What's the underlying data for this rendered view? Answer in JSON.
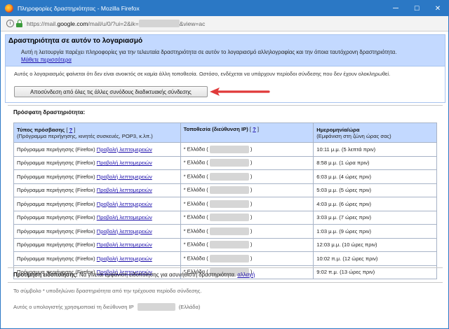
{
  "window": {
    "title": "Πληροφορίες δραστηριότητας - Mozilla Firefox",
    "controls": {
      "minimize": "─",
      "maximize": "☐",
      "close": "✕"
    }
  },
  "urlbar": {
    "prefix": "https://mail.",
    "domain": "google.com",
    "path": "/mail/u/0/?ui=2&ik=",
    "suffix": "&view=ac"
  },
  "banner": {
    "heading": "Δραστηριότητα σε αυτόν το λογαριασμό",
    "description": "Αυτή η λειτουργία παρέχει πληροφορίες για την τελευταία δραστηριότητα σε αυτόν το λογαριασμό αλληλογραφίας και την όποια ταυτόχρονη δραστηριότητα.",
    "learn_more": "Μάθετε περισσότερα"
  },
  "notice": "Αυτός ο λογαριασμός φαίνεται ότι δεν είναι ανοικτός σε καμία άλλη τοποθεσία. Ωστόσο, ενδέχεται να υπάρχουν περίοδοι σύνδεσης που δεν έχουν ολοκληρωθεί.",
  "signout_button": "Αποσύνδεση από όλες τις άλλες συνόδους διαδικτυακής σύνδεσης",
  "recent_heading": "Πρόσφατη δραστηριότητα:",
  "table": {
    "headers": {
      "access_type": "Τύπος πρόσβασης",
      "access_type_sub": "(Πρόγραμμα περιήγησης, κινητές συσκευές, POP3, κ.λπ.)",
      "location": "Τοποθεσία (διεύθυνση IP)",
      "datetime": "Ημερομηνία/ώρα",
      "datetime_sub": "(Εμφάνιση στη ζώνη ώρας σας)",
      "help_open": "[",
      "help_link": "?",
      "help_close": "]"
    },
    "rows": [
      {
        "access": "Πρόγραμμα περιήγησης (Firefox)",
        "details": "Προβολή λεπτομερειών",
        "location": "* Ελλάδα (",
        "location_end": ")",
        "time": "10:11 μ.μ. (5 λεπτά πριν)"
      },
      {
        "access": "Πρόγραμμα περιήγησης (Firefox)",
        "details": "Προβολή λεπτομερειών",
        "location": "* Ελλάδα (",
        "location_end": ")",
        "time": "8:58 μ.μ. (1 ώρα πριν)"
      },
      {
        "access": "Πρόγραμμα περιήγησης (Firefox)",
        "details": "Προβολή λεπτομερειών",
        "location": "* Ελλάδα (",
        "location_end": ")",
        "time": "6:03 μ.μ. (4 ώρες πριν)"
      },
      {
        "access": "Πρόγραμμα περιήγησης (Firefox)",
        "details": "Προβολή λεπτομερειών",
        "location": "* Ελλάδα (",
        "location_end": ")",
        "time": "5:03 μ.μ. (5 ώρες πριν)"
      },
      {
        "access": "Πρόγραμμα περιήγησης (Firefox)",
        "details": "Προβολή λεπτομερειών",
        "location": "* Ελλάδα (",
        "location_end": ")",
        "time": "4:03 μ.μ. (6 ώρες πριν)"
      },
      {
        "access": "Πρόγραμμα περιήγησης (Firefox)",
        "details": "Προβολή λεπτομερειών",
        "location": "* Ελλάδα (",
        "location_end": ")",
        "time": "3:03 μ.μ. (7 ώρες πριν)"
      },
      {
        "access": "Πρόγραμμα περιήγησης (Firefox)",
        "details": "Προβολή λεπτομερειών",
        "location": "* Ελλάδα (",
        "location_end": ")",
        "time": "1:03 μ.μ. (9 ώρες πριν)"
      },
      {
        "access": "Πρόγραμμα περιήγησης (Firefox)",
        "details": "Προβολή λεπτομερειών",
        "location": "* Ελλάδα (",
        "location_end": ")",
        "time": "12:03 μ.μ. (10 ώρες πριν)"
      },
      {
        "access": "Πρόγραμμα περιήγησης (Firefox)",
        "details": "Προβολή λεπτομερειών",
        "location": "* Ελλάδα (",
        "location_end": ")",
        "time": "10:02 π.μ. (12 ώρες πριν)"
      },
      {
        "access": "Πρόγραμμα περιήγησης (Firefox)",
        "details": "Προβολή λεπτομερειών",
        "location": "* Ελλάδα (",
        "location_end": ")",
        "time": "9:02 π.μ. (13 ώρες πριν)"
      }
    ]
  },
  "preference": {
    "label": "Προτίμηση ειδοποίησης:",
    "text": "Να γίνεται εμφάνιση ειδοποίησης για ασυνήθιστη δραστηριότητα.",
    "change_link": "αλλαγή"
  },
  "footnote": "Το σύμβολο * υποδηλώνει δραστηριότητα από την τρέχουσα περίοδο σύνδεσης.",
  "ip_line": {
    "text": "Αυτός ο υπολογιστής χρησιμοποιεί τη διεύθυνση IP",
    "country": "(Ελλάδα)"
  },
  "colors": {
    "titlebar": "#2b78c5",
    "banner": "#c3d9ff",
    "link": "#1a0dab",
    "arrow": "#e03a3a"
  }
}
